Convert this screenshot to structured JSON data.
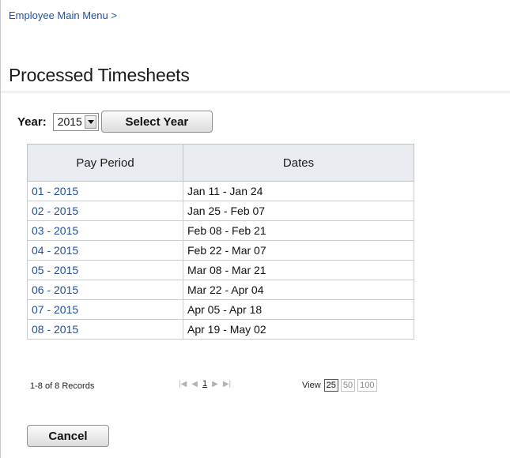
{
  "breadcrumb": "Employee Main Menu >",
  "page_title": "Processed Timesheets",
  "year_filter": {
    "label": "Year:",
    "selected": "2015",
    "button": "Select Year"
  },
  "table": {
    "columns": [
      "Pay Period",
      "Dates"
    ],
    "rows": [
      {
        "period": "01 - 2015",
        "dates": "Jan 11 - Jan 24"
      },
      {
        "period": "02 - 2015",
        "dates": "Jan 25 - Feb 07"
      },
      {
        "period": "03 - 2015",
        "dates": "Feb 08 - Feb 21"
      },
      {
        "period": "04 - 2015",
        "dates": "Feb 22 - Mar 07"
      },
      {
        "period": "05 - 2015",
        "dates": "Mar 08 - Mar 21"
      },
      {
        "period": "06 - 2015",
        "dates": "Mar 22 - Apr 04"
      },
      {
        "period": "07 - 2015",
        "dates": "Apr 05 - Apr 18"
      },
      {
        "period": "08 - 2015",
        "dates": "Apr 19 - May 02"
      }
    ]
  },
  "pager": {
    "records": "1-8 of 8 Records",
    "current_page": "1",
    "view_label": "View",
    "view_options": [
      "25",
      "50",
      "100"
    ],
    "view_selected": "25"
  },
  "cancel_label": "Cancel",
  "colors": {
    "link": "#1f4fa0",
    "header_bg": "#e8ecf1"
  }
}
